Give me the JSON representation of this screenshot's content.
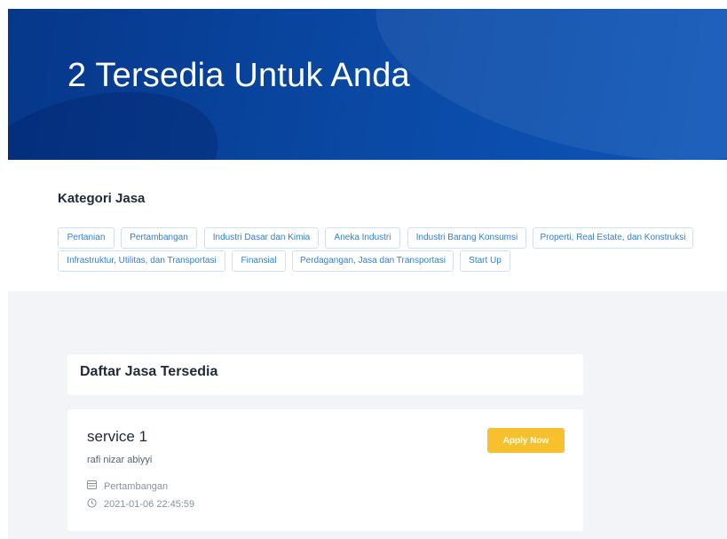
{
  "hero": {
    "title": "2 Tersedia Untuk Anda"
  },
  "categories": {
    "title": "Kategori Jasa",
    "items": [
      "Pertanian",
      "Pertambangan",
      "Industri Dasar dan Kimia",
      "Aneka Industri",
      "Industri Barang Konsumsi",
      "Properti, Real Estate, dan Konstruksi",
      "Infrastruktur, Utilitas, dan Transportasi",
      "Finansial",
      "Perdagangan, Jasa dan Transportasi",
      "Start Up"
    ]
  },
  "services": {
    "title": "Daftar Jasa Tersedia",
    "items": [
      {
        "name": "service 1",
        "owner": "rafi nizar abiyyi",
        "category": "Pertambangan",
        "datetime": "2021-01-06 22:45:59",
        "apply_label": "Apply Now"
      }
    ]
  },
  "colors": {
    "hero_bg": "#0a4aa6",
    "tag_text": "#2f80d8",
    "apply_bg": "#f7c12d",
    "section_bg": "#f3f4f7"
  }
}
